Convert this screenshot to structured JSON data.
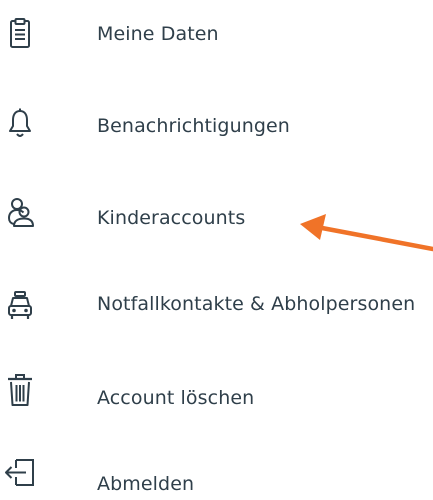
{
  "menu": {
    "items": [
      {
        "label": "Meine Daten",
        "icon": "clipboard-icon"
      },
      {
        "label": "Benachrichtigungen",
        "icon": "bell-icon"
      },
      {
        "label": "Kinderaccounts",
        "icon": "users-icon"
      },
      {
        "label": "Notfallkontakte & Abholpersonen",
        "icon": "car-icon"
      },
      {
        "label": "Account löschen",
        "icon": "trash-icon"
      },
      {
        "label": "Abmelden",
        "icon": "logout-icon"
      }
    ]
  },
  "annotation": {
    "icon": "arrow-icon",
    "color": "#f07328",
    "points_to": "Kinderaccounts"
  },
  "colors": {
    "text": "#2f3f4a",
    "icon": "#2f3f4a",
    "background": "#ffffff"
  }
}
